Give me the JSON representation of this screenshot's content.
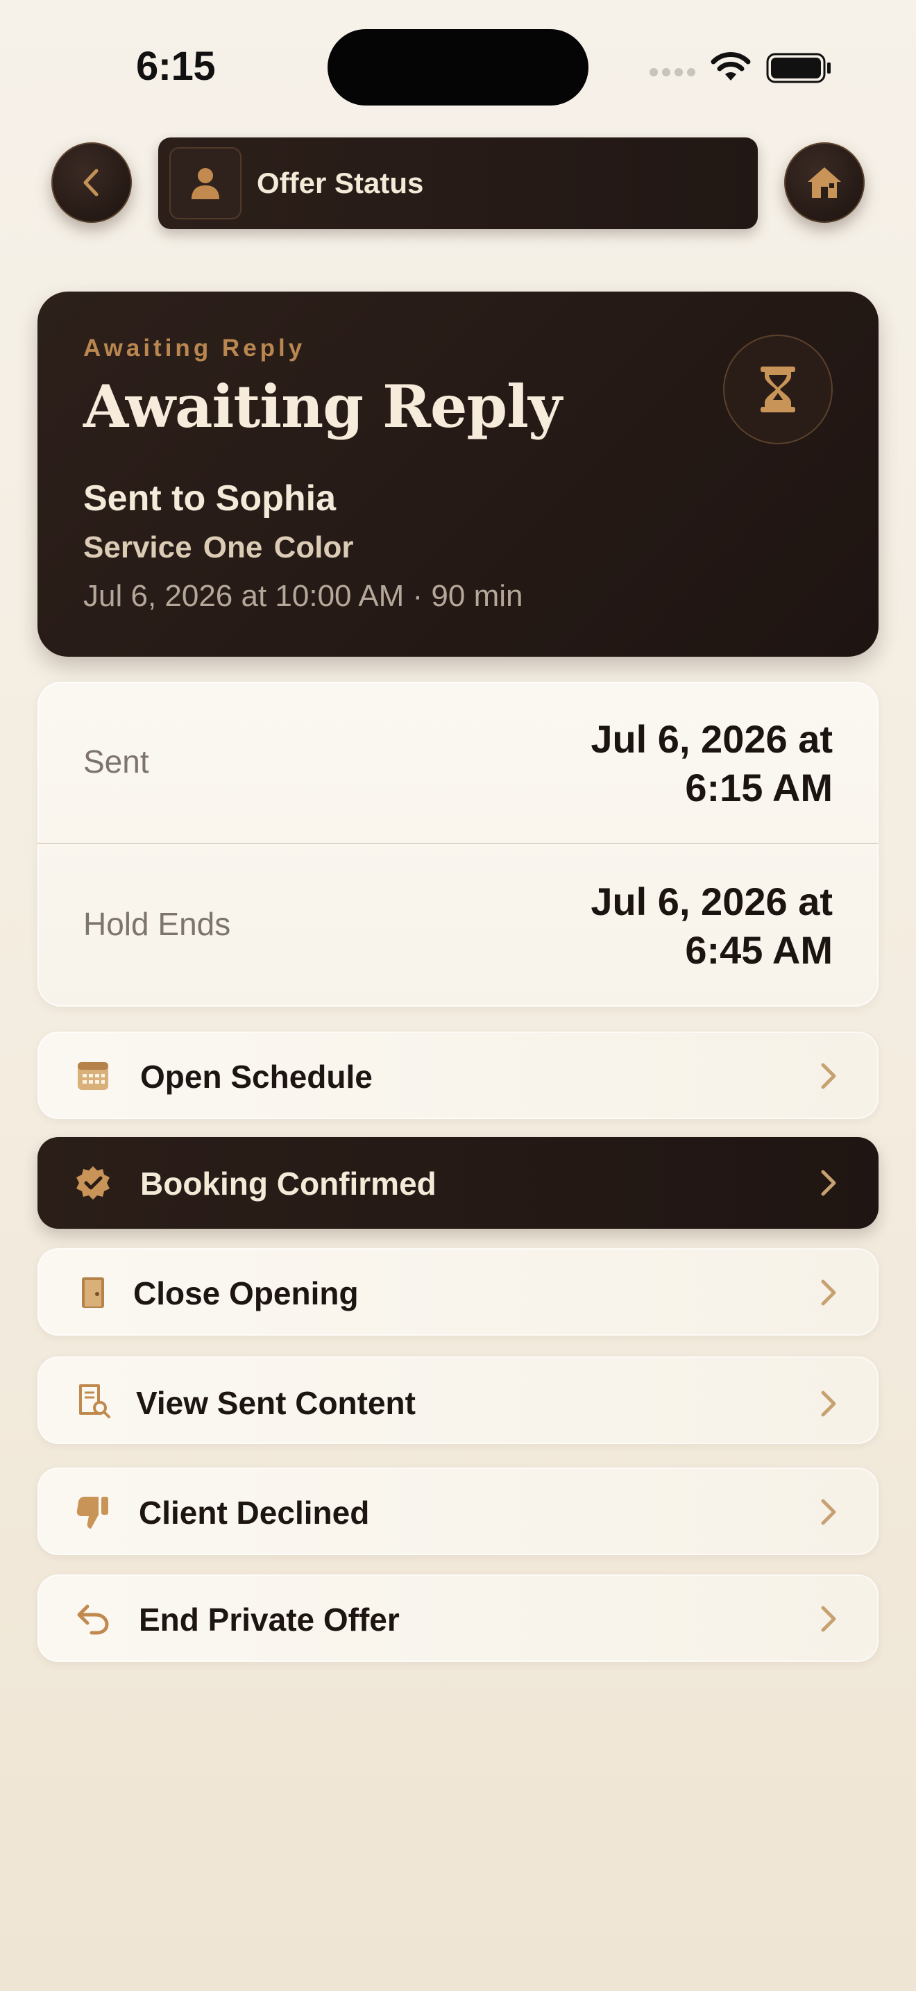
{
  "status_bar": {
    "time": "6:15"
  },
  "nav": {
    "title": "Offer Status"
  },
  "hero": {
    "eyebrow": "Awaiting Reply",
    "title": "Awaiting Reply",
    "sent_to": "Sent to Sophia",
    "service": "Service  One Color",
    "datetime": "Jul 6, 2026 at 10:00 AM · 90 min"
  },
  "details": [
    {
      "label": "Sent",
      "value_line1": "Jul 6, 2026 at",
      "value_line2": "6:15 AM"
    },
    {
      "label": "Hold Ends",
      "value_line1": "Jul 6, 2026 at",
      "value_line2": "6:45 AM"
    }
  ],
  "actions": [
    {
      "label": "Open Schedule",
      "icon": "calendar-icon"
    },
    {
      "label": "Booking Confirmed",
      "icon": "check-badge-icon"
    },
    {
      "label": "Close Opening",
      "icon": "door-icon"
    },
    {
      "label": "View Sent Content",
      "icon": "document-search-icon"
    },
    {
      "label": "Client Declined",
      "icon": "thumbs-down-icon"
    },
    {
      "label": "End Private Offer",
      "icon": "undo-arrow-icon"
    }
  ],
  "colors": {
    "accent": "#b9874f",
    "dark": "#231814",
    "background": "#f3ecdf"
  }
}
